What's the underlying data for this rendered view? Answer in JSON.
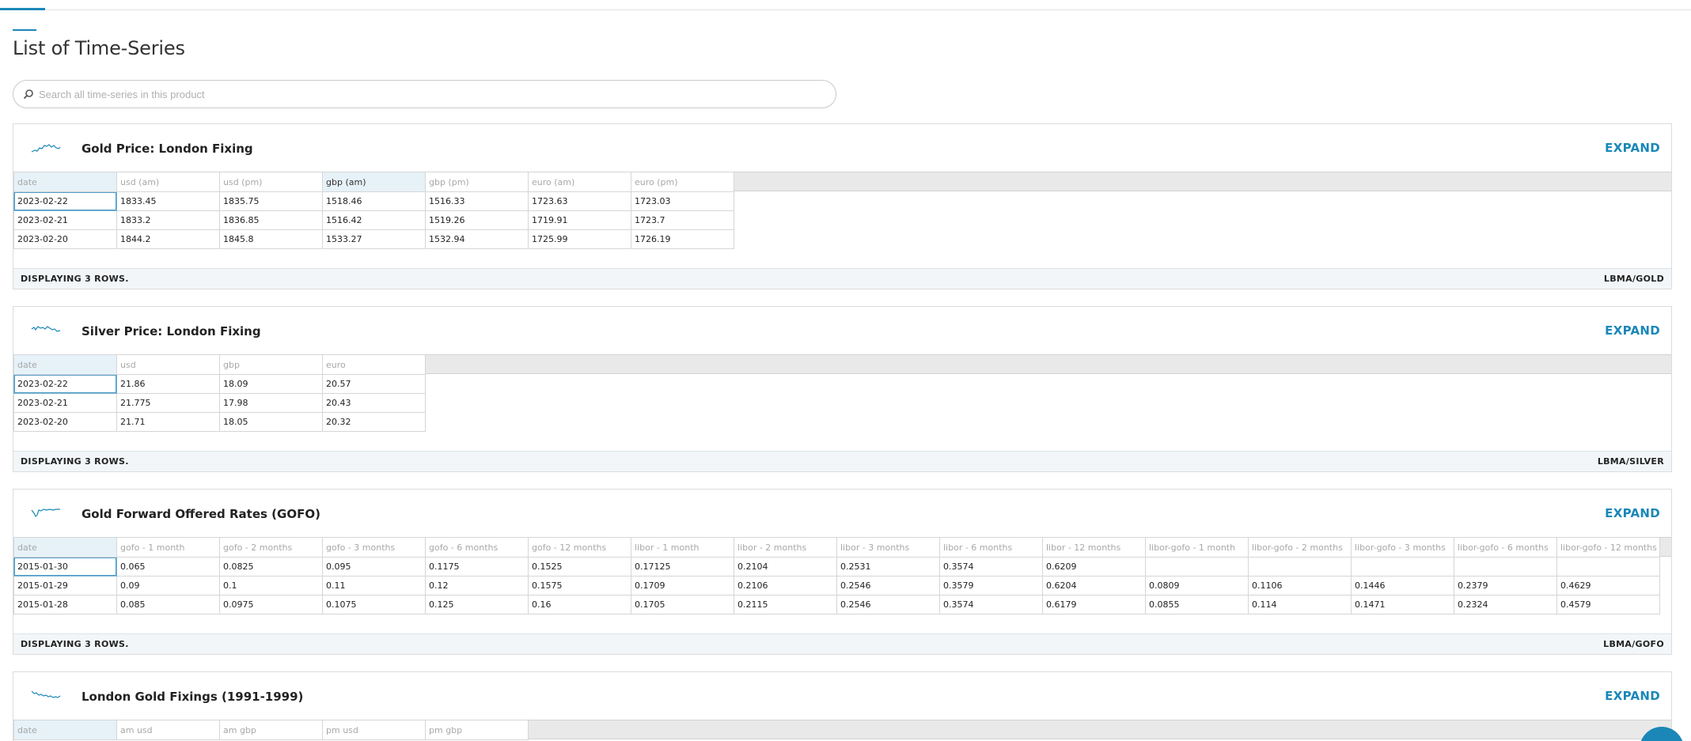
{
  "page": {
    "title": "List of Time-Series",
    "search_placeholder": "Search all time-series in this product"
  },
  "colors": {
    "accent": "#1a87b8",
    "header_bg": "#e9e9e9",
    "footer_bg": "#f2f6f9",
    "first_col_bg": "#e6f2f8"
  },
  "cards": [
    {
      "title": "Gold Price: London Fixing",
      "expand_label": "EXPAND",
      "columns": [
        "date",
        "usd (am)",
        "usd (pm)",
        "gbp (am)",
        "gbp (pm)",
        "euro (am)",
        "euro (pm)"
      ],
      "rows": [
        [
          "2023-02-22",
          "1833.45",
          "1835.75",
          "1518.46",
          "1516.33",
          "1723.63",
          "1723.03"
        ],
        [
          "2023-02-21",
          "1833.2",
          "1836.85",
          "1516.42",
          "1519.26",
          "1719.91",
          "1723.7"
        ],
        [
          "2023-02-20",
          "1844.2",
          "1845.8",
          "1533.27",
          "1532.94",
          "1725.99",
          "1726.19"
        ]
      ],
      "footer_left": "DISPLAYING 3 ROWS.",
      "footer_right": "LBMA/GOLD"
    },
    {
      "title": "Silver Price: London Fixing",
      "expand_label": "EXPAND",
      "columns": [
        "date",
        "usd",
        "gbp",
        "euro"
      ],
      "rows": [
        [
          "2023-02-22",
          "21.86",
          "18.09",
          "20.57"
        ],
        [
          "2023-02-21",
          "21.775",
          "17.98",
          "20.43"
        ],
        [
          "2023-02-20",
          "21.71",
          "18.05",
          "20.32"
        ]
      ],
      "footer_left": "DISPLAYING 3 ROWS.",
      "footer_right": "LBMA/SILVER"
    },
    {
      "title": "Gold Forward Offered Rates (GOFO)",
      "expand_label": "EXPAND",
      "columns": [
        "date",
        "gofo - 1 month",
        "gofo - 2 months",
        "gofo - 3 months",
        "gofo - 6 months",
        "gofo - 12 months",
        "libor - 1 month",
        "libor - 2 months",
        "libor - 3 months",
        "libor - 6 months",
        "libor - 12 months",
        "libor-gofo - 1 month",
        "libor-gofo - 2 months",
        "libor-gofo - 3 months",
        "libor-gofo - 6 months",
        "libor-gofo - 12 months"
      ],
      "rows": [
        [
          "2015-01-30",
          "0.065",
          "0.0825",
          "0.095",
          "0.1175",
          "0.1525",
          "0.17125",
          "0.2104",
          "0.2531",
          "0.3574",
          "0.6209",
          "",
          "",
          "",
          "",
          ""
        ],
        [
          "2015-01-29",
          "0.09",
          "0.1",
          "0.11",
          "0.12",
          "0.1575",
          "0.1709",
          "0.2106",
          "0.2546",
          "0.3579",
          "0.6204",
          "0.0809",
          "0.1106",
          "0.1446",
          "0.2379",
          "0.4629"
        ],
        [
          "2015-01-28",
          "0.085",
          "0.0975",
          "0.1075",
          "0.125",
          "0.16",
          "0.1705",
          "0.2115",
          "0.2546",
          "0.3574",
          "0.6179",
          "0.0855",
          "0.114",
          "0.1471",
          "0.2324",
          "0.4579"
        ]
      ],
      "footer_left": "DISPLAYING 3 ROWS.",
      "footer_right": "LBMA/GOFO"
    },
    {
      "title": "London Gold Fixings (1991-1999)",
      "expand_label": "EXPAND",
      "columns": [
        "date",
        "am usd",
        "am gbp",
        "pm usd",
        "pm gbp"
      ],
      "rows": [],
      "footer_left": "",
      "footer_right": ""
    }
  ]
}
